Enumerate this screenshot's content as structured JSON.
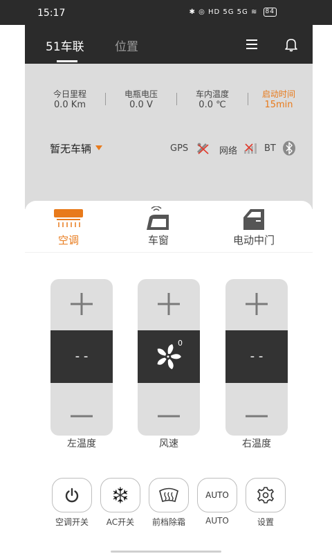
{
  "status_bar": {
    "time": "15:17",
    "icons_text": "✱ ◎ HD 5G 5G ≋",
    "battery": "84"
  },
  "nav": {
    "tabs": [
      {
        "label": "51车联"
      },
      {
        "label": "位置"
      }
    ]
  },
  "stats": [
    {
      "label": "今日里程",
      "value": "0.0 Km"
    },
    {
      "label": "电瓶电压",
      "value": "0.0 V"
    },
    {
      "label": "车内温度",
      "value": "0.0 ℃"
    },
    {
      "label": "启动时间",
      "value": "15min"
    }
  ],
  "vehicle": {
    "name": "暂无车辆"
  },
  "connectivity": {
    "gps": "GPS",
    "network": "网络",
    "bt": "BT"
  },
  "categories": [
    {
      "label": "空调"
    },
    {
      "label": "车窗"
    },
    {
      "label": "电动中门"
    }
  ],
  "sliders": [
    {
      "label": "左温度",
      "value": "- -"
    },
    {
      "label": "风速",
      "value": "0"
    },
    {
      "label": "右温度",
      "value": "- -"
    }
  ],
  "controls": [
    {
      "label": "空调开关",
      "text": ""
    },
    {
      "label": "AC开关",
      "text": ""
    },
    {
      "label": "前档除霜",
      "text": ""
    },
    {
      "label": "AUTO",
      "text": "AUTO"
    },
    {
      "label": "设置",
      "text": ""
    }
  ],
  "colors": {
    "accent": "#e87a1b",
    "dark": "#2b2b2b",
    "panel": "#dcdcdc",
    "slider": "#dedede"
  }
}
